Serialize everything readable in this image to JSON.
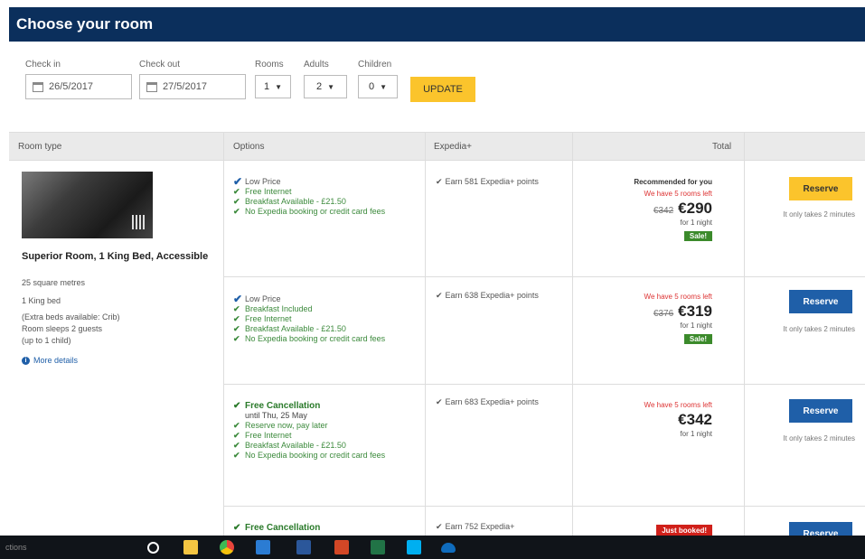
{
  "page": {
    "title": "Choose your room"
  },
  "search": {
    "checkin_label": "Check in",
    "checkin_value": "26/5/2017",
    "checkout_label": "Check out",
    "checkout_value": "27/5/2017",
    "rooms_label": "Rooms",
    "rooms_value": "1",
    "adults_label": "Adults",
    "adults_value": "2",
    "children_label": "Children",
    "children_value": "0",
    "update_label": "UPDATE"
  },
  "table": {
    "headers": [
      "Room type",
      "Options",
      "Expedia+",
      "Total"
    ]
  },
  "room": {
    "name": "Superior Room, 1 King Bed, Accessible",
    "details": [
      "25 square metres",
      "1 King bed",
      "(Extra beds available: Crib)",
      "Room sleeps 2 guests",
      "(up to 1 child)"
    ],
    "more_details": "More details"
  },
  "rates": [
    {
      "options": [
        {
          "kind": "blue",
          "text": "Low Price"
        },
        {
          "kind": "tick",
          "text": "Free Internet"
        },
        {
          "kind": "tick",
          "text": "Breakfast Available - £21.50"
        },
        {
          "kind": "tick",
          "text": "No Expedia booking or credit card fees"
        }
      ],
      "expedia": "Earn 581 Expedia+ points",
      "recommended": "Recommended for you",
      "rooms_left": "We have 5 rooms left",
      "old_price": "€342",
      "price": "€290",
      "per_night": "for 1 night",
      "badge": "Sale!",
      "reserve": "Reserve",
      "takes": "It only takes 2 minutes"
    },
    {
      "options": [
        {
          "kind": "blue",
          "text": "Low Price"
        },
        {
          "kind": "tick",
          "text": "Breakfast Included"
        },
        {
          "kind": "tick",
          "text": "Free Internet"
        },
        {
          "kind": "tick",
          "text": "Breakfast Available - £21.50"
        },
        {
          "kind": "tick",
          "text": "No Expedia booking or credit card fees"
        }
      ],
      "expedia": "Earn 638 Expedia+ points",
      "rooms_left": "We have 5 rooms left",
      "old_price": "€376",
      "price": "€319",
      "per_night": "for 1 night",
      "badge": "Sale!",
      "reserve": "Reserve",
      "takes": "It only takes 2 minutes"
    },
    {
      "options": [
        {
          "kind": "strong",
          "text": "Free Cancellation"
        },
        {
          "kind": "plain",
          "text": "until Thu, 25 May"
        },
        {
          "kind": "tick",
          "text": "Reserve now, pay later"
        },
        {
          "kind": "tick",
          "text": "Free Internet"
        },
        {
          "kind": "tick",
          "text": "Breakfast Available - £21.50"
        },
        {
          "kind": "tick",
          "text": "No Expedia booking or credit card fees"
        }
      ],
      "expedia": "Earn 683 Expedia+ points",
      "rooms_left": "We have 5 rooms left",
      "price": "€342",
      "per_night": "for 1 night",
      "reserve": "Reserve",
      "takes": "It only takes 2 minutes"
    },
    {
      "options": [
        {
          "kind": "strong",
          "text": "Free Cancellation"
        }
      ],
      "expedia": "Earn 752 Expedia+",
      "booked": "Just booked!",
      "reserve": "Reserve"
    }
  ],
  "taskbar": {
    "search_text": "ctions",
    "icons": [
      {
        "name": "cortana",
        "color": "#ffffff"
      },
      {
        "name": "file-explorer",
        "color": "#f4c542"
      },
      {
        "name": "chrome",
        "color": "#e8453c"
      },
      {
        "name": "outlook",
        "color": "#2b7cd3"
      },
      {
        "name": "word",
        "color": "#2b579a"
      },
      {
        "name": "powerpoint",
        "color": "#d24726"
      },
      {
        "name": "excel",
        "color": "#217346"
      },
      {
        "name": "skype",
        "color": "#00aff0"
      },
      {
        "name": "onedrive",
        "color": "#0f6cbd"
      }
    ]
  },
  "colors": {
    "header_bg": "#0b2f5c",
    "yellow": "#fbc42c",
    "blue": "#1f5fa8",
    "green": "#3b8a2b",
    "red": "#d0201a"
  }
}
